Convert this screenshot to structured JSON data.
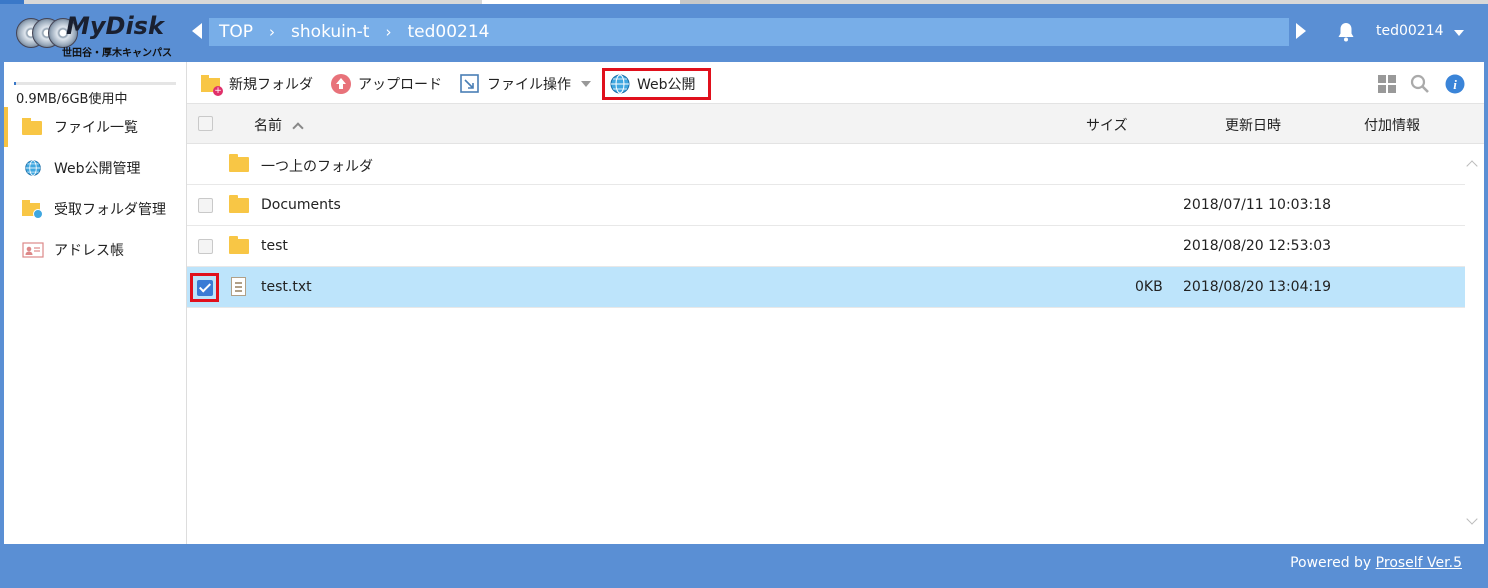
{
  "header": {
    "logo_name": "MyDisk",
    "logo_sub": "世田谷・厚木キャンパス",
    "breadcrumb": [
      "TOP",
      "shokuin-t",
      "ted00214"
    ],
    "user": "ted00214"
  },
  "sidebar": {
    "quota": "0.9MB/6GB使用中",
    "quota_fraction": 0.00015,
    "items": [
      {
        "label": "ファイル一覧"
      },
      {
        "label": "Web公開管理"
      },
      {
        "label": "受取フォルダ管理"
      },
      {
        "label": "アドレス帳"
      }
    ]
  },
  "toolbar": {
    "new_folder": "新規フォルダ",
    "upload": "アップロード",
    "file_ops": "ファイル操作",
    "web_publish": "Web公開"
  },
  "table": {
    "headers": {
      "name": "名前",
      "size": "サイズ",
      "updated": "更新日時",
      "info": "付加情報"
    },
    "parent": "一つ上のフォルダ",
    "rows": [
      {
        "name": "Documents",
        "size": "",
        "updated": "2018/07/11 10:03:18",
        "type": "folder",
        "checked": false
      },
      {
        "name": "test",
        "size": "",
        "updated": "2018/08/20 12:53:03",
        "type": "folder",
        "checked": false
      },
      {
        "name": "test.txt",
        "size": "0KB",
        "updated": "2018/08/20 13:04:19",
        "type": "file",
        "checked": true
      }
    ]
  },
  "footer": {
    "powered_prefix": "Powered by",
    "powered_link": "Proself Ver.5"
  },
  "colors": {
    "header_bg": "#5a8fd4",
    "breadcrumb_bg": "#78aee8",
    "selected_row": "#bde4fb",
    "highlight_red": "#e0101c",
    "folder": "#f8c645"
  }
}
